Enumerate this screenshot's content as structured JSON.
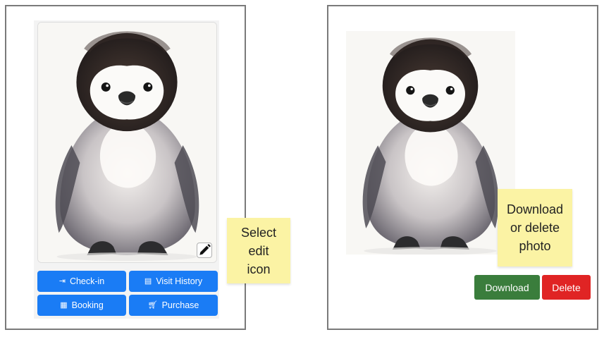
{
  "left": {
    "buttons": {
      "checkin": {
        "label": "Check-in",
        "icon": "sign-in-icon"
      },
      "visit_history": {
        "label": "Visit History",
        "icon": "document-icon"
      },
      "booking": {
        "label": "Booking",
        "icon": "calendar-icon"
      },
      "purchase": {
        "label": "Purchase",
        "icon": "cart-icon"
      }
    },
    "edit_icon": "pencil-icon",
    "note": "Select edit icon"
  },
  "right": {
    "note": "Download or delete photo",
    "download_label": "Download",
    "delete_label": "Delete"
  },
  "colors": {
    "primary": "#1a7cf5",
    "download": "#3a7d3c",
    "delete": "#e02424",
    "sticky": "#fbf3a4",
    "border": "#7a7a7a"
  }
}
